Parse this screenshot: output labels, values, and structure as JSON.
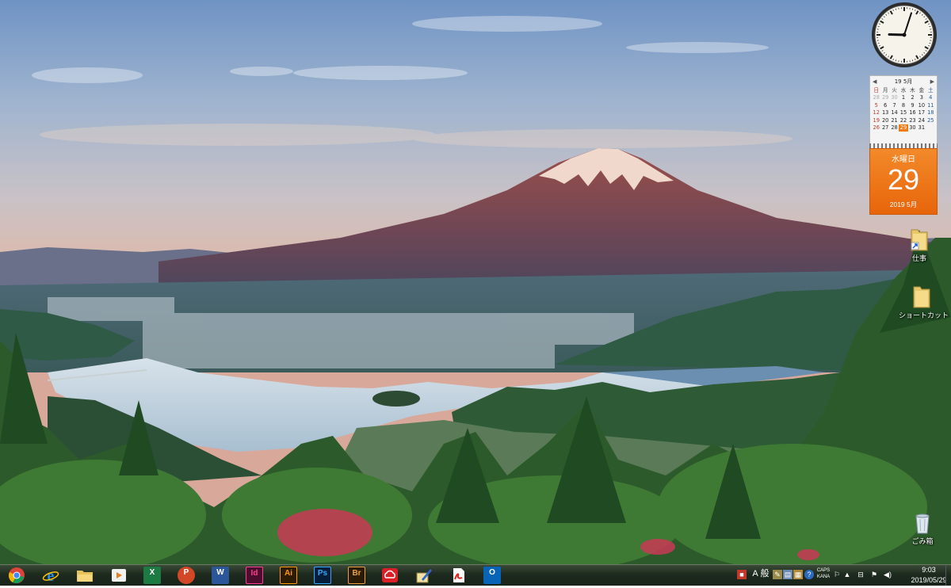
{
  "desktop": {
    "icons": [
      {
        "label": "仕事",
        "icon": "folder-shortcut-icon"
      },
      {
        "label": "ショートカット",
        "icon": "folder-icon"
      },
      {
        "label": "ごみ箱",
        "icon": "recycle-bin-icon"
      }
    ]
  },
  "clock_gadget": {
    "hour": 9,
    "minute": 3
  },
  "calendar_gadget": {
    "header": "19 5月",
    "weekdays": [
      "日",
      "月",
      "火",
      "水",
      "木",
      "金",
      "土"
    ],
    "weeks": [
      [
        "28",
        "29",
        "30",
        "1",
        "2",
        "3",
        "4"
      ],
      [
        "5",
        "6",
        "7",
        "8",
        "9",
        "10",
        "11"
      ],
      [
        "12",
        "13",
        "14",
        "15",
        "16",
        "17",
        "18"
      ],
      [
        "19",
        "20",
        "21",
        "22",
        "23",
        "24",
        "25"
      ],
      [
        "26",
        "27",
        "28",
        "29",
        "30",
        "31",
        ""
      ]
    ],
    "today_weekday": "水曜日",
    "today_number": "29",
    "today_footer": "2019 5月"
  },
  "taskbar": {
    "apps": [
      {
        "name": "chrome-icon"
      },
      {
        "name": "internet-explorer-icon"
      },
      {
        "name": "file-explorer-icon"
      },
      {
        "name": "media-player-icon"
      },
      {
        "name": "excel-icon",
        "text": "X"
      },
      {
        "name": "powerpoint-icon",
        "text": "P"
      },
      {
        "name": "word-icon",
        "text": "W"
      },
      {
        "name": "indesign-icon",
        "text": "Id"
      },
      {
        "name": "illustrator-icon",
        "text": "Ai"
      },
      {
        "name": "photoshop-icon",
        "text": "Ps"
      },
      {
        "name": "bridge-icon",
        "text": "Br"
      },
      {
        "name": "creative-cloud-icon"
      },
      {
        "name": "paint-tool-icon"
      },
      {
        "name": "acrobat-icon"
      },
      {
        "name": "outlook-icon",
        "text": "O"
      }
    ],
    "tray": {
      "ime_mode": "A",
      "ime_kanji": "般",
      "caps": "CAPS",
      "kana": "KANA",
      "time": "9:03",
      "date": "2019/05/29"
    }
  },
  "colors": {
    "calendar_accent": "#e8650a",
    "taskbar": "#1d2a1e"
  }
}
